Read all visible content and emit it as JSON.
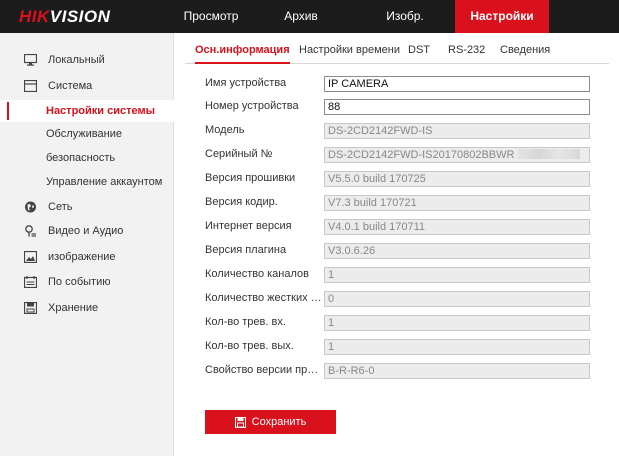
{
  "logo": {
    "brand": "HIKVISION"
  },
  "nav": {
    "items": [
      {
        "label": "Просмотр"
      },
      {
        "label": "Архив"
      },
      {
        "label": "Изобр."
      },
      {
        "label": "Настройки"
      }
    ],
    "active": "Настройки"
  },
  "sidebar": {
    "items": [
      {
        "label": "Локальный",
        "icon": "monitor-icon"
      },
      {
        "label": "Система",
        "icon": "system-icon"
      },
      {
        "label": "Настройки системы"
      },
      {
        "label": "Обслуживание"
      },
      {
        "label": "безопасность"
      },
      {
        "label": "Управление аккаунтом"
      },
      {
        "label": "Сеть",
        "icon": "globe-icon"
      },
      {
        "label": "Видео и Аудио",
        "icon": "microphone-icon"
      },
      {
        "label": "изображение",
        "icon": "image-icon"
      },
      {
        "label": "По событию",
        "icon": "calendar-icon"
      },
      {
        "label": "Хранение",
        "icon": "storage-icon"
      }
    ],
    "active": "Настройки системы"
  },
  "tabs": [
    {
      "label": "Осн.информация"
    },
    {
      "label": "Настройки времени"
    },
    {
      "label": "DST"
    },
    {
      "label": "RS-232"
    },
    {
      "label": "Сведения"
    }
  ],
  "form": {
    "fields": [
      {
        "label": "Имя устройства",
        "value": "IP CAMERA"
      },
      {
        "label": "Номер устройства",
        "value": "88"
      },
      {
        "label": "Модель",
        "value": "DS-2CD2142FWD-IS"
      },
      {
        "label": "Серийный №",
        "value": "DS-2CD2142FWD-IS20170802BBWR"
      },
      {
        "label": "Версия прошивки",
        "value": "V5.5.0 build 170725"
      },
      {
        "label": "Версия кодир.",
        "value": "V7.3 build 170721"
      },
      {
        "label": "Интернет версия",
        "value": "V4.0.1 build 170711"
      },
      {
        "label": "Версия плагина",
        "value": "V3.0.6.26"
      },
      {
        "label": "Количество каналов",
        "value": "1"
      },
      {
        "label": "Количество жестких дис…",
        "value": "0"
      },
      {
        "label": "Кол-во трев. вх.",
        "value": "1"
      },
      {
        "label": "Кол-во трев. вых.",
        "value": "1"
      },
      {
        "label": "Свойство версии проши…",
        "value": "B-R-R6-0"
      }
    ]
  },
  "save_button": {
    "label": "Сохранить"
  },
  "colors": {
    "accent": "#d9111c",
    "topbar": "#1c1c1c",
    "sidebar": "#f2f2f2"
  }
}
